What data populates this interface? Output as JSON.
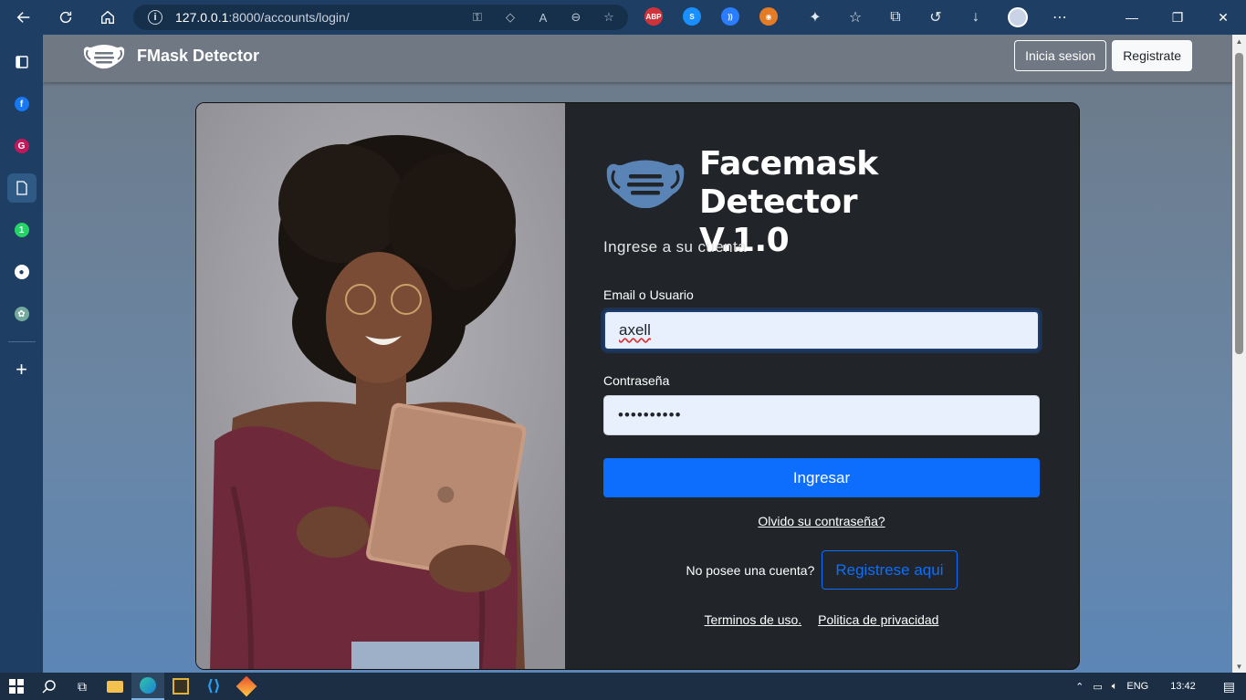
{
  "browser": {
    "url_host": "127.0.0.1",
    "url_rest": ":8000/accounts/login/",
    "extensions": [
      {
        "name": "adblock-plus",
        "label": "ABP",
        "color": "#d0323a"
      },
      {
        "name": "shazam",
        "label": "",
        "color": "#1a8fff"
      },
      {
        "name": "read-aloud",
        "label": "",
        "color": "#2a7dff"
      },
      {
        "name": "firefox-like",
        "label": "",
        "color": "#e67b25"
      }
    ]
  },
  "navbar": {
    "brand": "FMask Detector",
    "login_button": "Inicia sesion",
    "register_button": "Registrate"
  },
  "login": {
    "title_line1": "Facemask Detector",
    "title_line2": "V.1.0",
    "subtitle": "Ingrese a su cuenta",
    "email_label": "Email o Usuario",
    "email_value": "axell",
    "password_label": "Contraseña",
    "password_value": "••••••••••",
    "submit": "Ingresar",
    "forgot": "Olvido su contraseña?",
    "no_account": "No posee una cuenta?",
    "register_here": "Registrese aqui",
    "terms": "Terminos de uso.",
    "privacy": "Politica de privacidad"
  },
  "taskbar": {
    "language": "ENG",
    "time": "13:42"
  },
  "colors": {
    "primary": "#0d6efd",
    "card": "#212529",
    "mask": "#5a84b5"
  }
}
